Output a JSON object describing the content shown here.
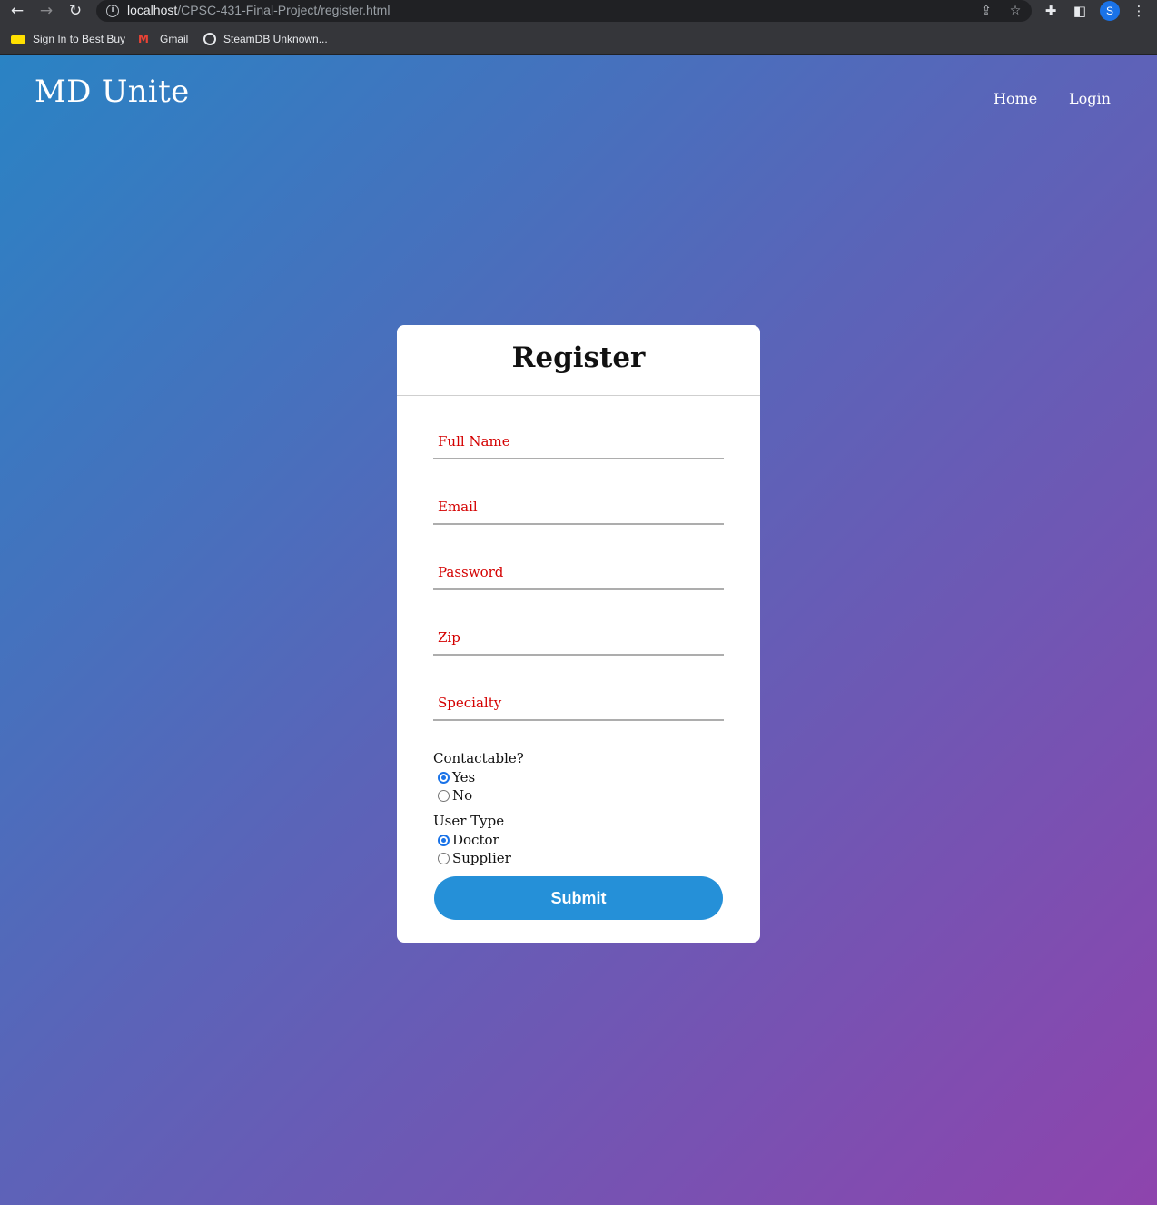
{
  "browser": {
    "url_host": "localhost",
    "url_path": "/CPSC-431-Final-Project/register.html",
    "profile_initial": "S",
    "bookmarks": [
      {
        "label": "Sign In to Best Buy"
      },
      {
        "label": "Gmail",
        "icon_glyph": "M"
      },
      {
        "label": "SteamDB Unknown..."
      }
    ]
  },
  "site": {
    "brand": "MD Unite",
    "nav": [
      "Home",
      "Login"
    ]
  },
  "form": {
    "title": "Register",
    "fields": [
      {
        "placeholder": "Full Name",
        "value": ""
      },
      {
        "placeholder": "Email",
        "value": ""
      },
      {
        "placeholder": "Password",
        "value": ""
      },
      {
        "placeholder": "Zip",
        "value": ""
      },
      {
        "placeholder": "Specialty",
        "value": ""
      }
    ],
    "contactable": {
      "label": "Contactable?",
      "options": [
        "Yes",
        "No"
      ],
      "selected": "Yes"
    },
    "user_type": {
      "label": "User Type",
      "options": [
        "Doctor",
        "Supplier"
      ],
      "selected": "Doctor"
    },
    "submit_label": "Submit"
  },
  "colors": {
    "gradient_start": "#2a83c4",
    "gradient_end": "#8e44ad",
    "placeholder_text": "#d40000",
    "submit_button": "#2590d8",
    "radio_checked": "#1a73e8"
  }
}
